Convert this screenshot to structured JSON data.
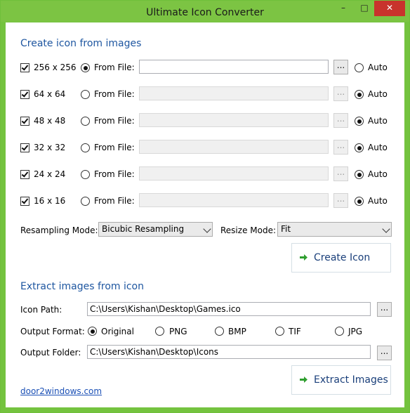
{
  "window": {
    "title": "Ultimate Icon Converter"
  },
  "titlebar_buttons": {
    "minimize": "–",
    "maximize": "□",
    "close": "✕"
  },
  "create": {
    "title": "Create icon from images",
    "rows": [
      {
        "size": "256 x 256",
        "checked": true,
        "from_file_label": "From File:",
        "from_file_selected": true,
        "path": "",
        "browse": "...",
        "auto_label": "Auto",
        "auto_selected": false
      },
      {
        "size": "64 x 64",
        "checked": true,
        "from_file_label": "From File:",
        "from_file_selected": false,
        "path": "",
        "browse": "...",
        "auto_label": "Auto",
        "auto_selected": true
      },
      {
        "size": "48 x 48",
        "checked": true,
        "from_file_label": "From File:",
        "from_file_selected": false,
        "path": "",
        "browse": "...",
        "auto_label": "Auto",
        "auto_selected": true
      },
      {
        "size": "32 x 32",
        "checked": true,
        "from_file_label": "From File:",
        "from_file_selected": false,
        "path": "",
        "browse": "...",
        "auto_label": "Auto",
        "auto_selected": true
      },
      {
        "size": "24 x 24",
        "checked": true,
        "from_file_label": "From File:",
        "from_file_selected": false,
        "path": "",
        "browse": "...",
        "auto_label": "Auto",
        "auto_selected": true
      },
      {
        "size": "16 x 16",
        "checked": true,
        "from_file_label": "From File:",
        "from_file_selected": false,
        "path": "",
        "browse": "...",
        "auto_label": "Auto",
        "auto_selected": true
      }
    ],
    "resampling_label": "Resampling Mode:",
    "resampling_value": "Bicubic Resampling",
    "resize_label": "Resize Mode:",
    "resize_value": "Fit",
    "create_button": "Create Icon"
  },
  "extract": {
    "title": "Extract images from icon",
    "icon_path_label": "Icon Path:",
    "icon_path_value": "C:\\Users\\Kishan\\Desktop\\Games.ico",
    "output_format_label": "Output Format:",
    "formats": [
      {
        "label": "Original",
        "selected": true
      },
      {
        "label": "PNG",
        "selected": false
      },
      {
        "label": "BMP",
        "selected": false
      },
      {
        "label": "TIF",
        "selected": false
      },
      {
        "label": "JPG",
        "selected": false
      }
    ],
    "output_folder_label": "Output Folder:",
    "output_folder_value": "C:\\Users\\Kishan\\Desktop\\Icons",
    "browse": "...",
    "extract_button": "Extract Images"
  },
  "footer": {
    "link": "door2windows.com"
  },
  "colors": {
    "frame": "#74c33f",
    "section_title": "#1e56a0",
    "close": "#c8332c",
    "arrow": "#2f9e2f"
  }
}
